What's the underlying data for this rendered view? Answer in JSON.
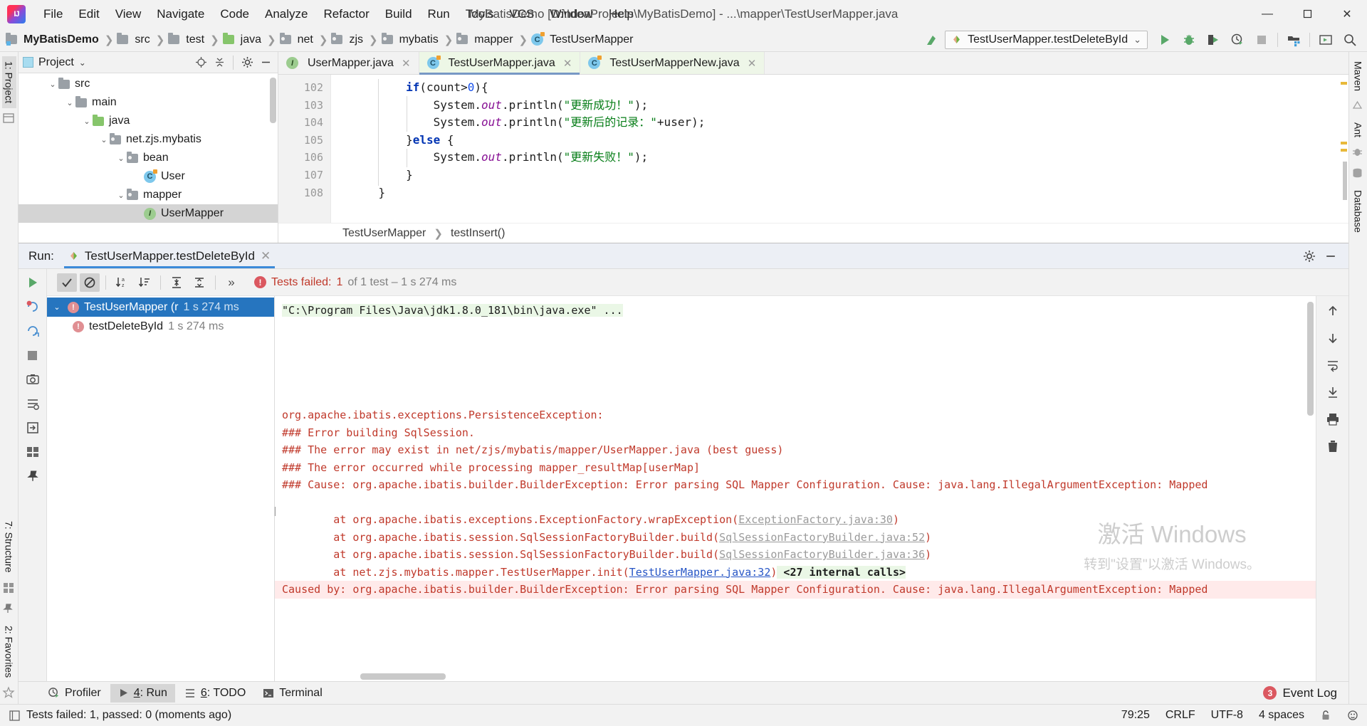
{
  "window": {
    "title": "MyBatisDemo [D:\\IdeaProjects\\MyBatisDemo] - ...\\mapper\\TestUserMapper.java",
    "minimize": "—",
    "maximize": "▢",
    "close": "✕"
  },
  "menu": {
    "items": [
      "File",
      "Edit",
      "View",
      "Navigate",
      "Code",
      "Analyze",
      "Refactor",
      "Build",
      "Run",
      "Tools",
      "VCS",
      "Window",
      "Help"
    ]
  },
  "breadcrumb": {
    "separator": "❯",
    "items": [
      {
        "label": "MyBatisDemo",
        "icon": "module-folder-icon"
      },
      {
        "label": "src",
        "icon": "folder-icon"
      },
      {
        "label": "test",
        "icon": "folder-icon"
      },
      {
        "label": "java",
        "icon": "source-folder-icon"
      },
      {
        "label": "net",
        "icon": "package-icon"
      },
      {
        "label": "zjs",
        "icon": "package-icon"
      },
      {
        "label": "mybatis",
        "icon": "package-icon"
      },
      {
        "label": "mapper",
        "icon": "package-icon"
      },
      {
        "label": "TestUserMapper",
        "icon": "class-icon"
      }
    ]
  },
  "toolbar": {
    "run_config": "TestUserMapper.testDeleteById",
    "dropdown_caret": "⌄",
    "buttons": [
      {
        "name": "run-button",
        "glyph": "▶"
      },
      {
        "name": "debug-button",
        "glyph": "bug"
      },
      {
        "name": "run-with-coverage-button",
        "glyph": "coverage"
      },
      {
        "name": "profiler-button",
        "glyph": "profile"
      },
      {
        "name": "stop-button",
        "glyph": "■"
      },
      {
        "name": "project-structure-button",
        "glyph": "struct"
      },
      {
        "name": "select-opened-file-button",
        "glyph": "selectfile"
      },
      {
        "name": "search-everywhere-button",
        "glyph": "search"
      }
    ]
  },
  "left_rail": {
    "items": [
      {
        "label": "1: Project",
        "selected": true
      },
      {
        "label": "2: Favorites",
        "selected": false
      },
      {
        "label": "7: Structure",
        "selected": false
      }
    ]
  },
  "right_rail": {
    "items": [
      {
        "label": "Maven"
      },
      {
        "label": "Ant"
      },
      {
        "label": "Database"
      }
    ]
  },
  "project": {
    "title": "Project",
    "title_caret": "⌄",
    "actions": [
      "locate-icon",
      "collapse-all-icon",
      "settings-icon",
      "hide-icon"
    ],
    "tree": [
      {
        "label": "src",
        "depth": 1,
        "chev": "⌄",
        "icon": "folder-icon",
        "selected": false
      },
      {
        "label": "main",
        "depth": 2,
        "chev": "⌄",
        "icon": "folder-icon",
        "selected": false
      },
      {
        "label": "java",
        "depth": 3,
        "chev": "⌄",
        "icon": "source-folder-icon",
        "selected": false
      },
      {
        "label": "net.zjs.mybatis",
        "depth": 4,
        "chev": "⌄",
        "icon": "package-icon",
        "selected": false
      },
      {
        "label": "bean",
        "depth": 5,
        "chev": "⌄",
        "icon": "package-icon",
        "selected": false
      },
      {
        "label": "User",
        "depth": 6,
        "chev": "",
        "icon": "class-icon",
        "selected": false
      },
      {
        "label": "mapper",
        "depth": 5,
        "chev": "⌄",
        "icon": "package-icon",
        "selected": false
      },
      {
        "label": "UserMapper",
        "depth": 6,
        "chev": "",
        "icon": "interface-icon",
        "selected": true
      }
    ]
  },
  "editor": {
    "tabs": [
      {
        "label": "UserMapper.java",
        "icon": "interface-icon",
        "active": false,
        "close": "✕"
      },
      {
        "label": "TestUserMapper.java",
        "icon": "class-icon",
        "active": true,
        "close": "✕"
      },
      {
        "label": "TestUserMapperNew.java",
        "icon": "class-icon",
        "active": false,
        "close": "✕"
      }
    ],
    "line_numbers": [
      "102",
      "103",
      "104",
      "105",
      "106",
      "107",
      "108"
    ],
    "code_lines": [
      "        if(count>0){",
      "            System.out.println(\"更新成功！\");",
      "            System.out.println(\"更新后的记录：\"+user);",
      "        }else {",
      "            System.out.println(\"更新失败！\");",
      "        }",
      "    }"
    ],
    "breadcrumb": {
      "separator": "❯",
      "items": [
        "TestUserMapper",
        "testInsert()"
      ]
    }
  },
  "run_window": {
    "label": "Run:",
    "tab_title": "TestUserMapper.testDeleteById",
    "tab_close": "✕",
    "settings_icon": "gear-icon",
    "hide_icon": "hide-icon",
    "left_tools": [
      {
        "name": "rerun-button",
        "glyph": "▶"
      },
      {
        "name": "rerun-failed-tests-button",
        "glyph": "rerunfail"
      },
      {
        "name": "toggle-auto-test-button",
        "glyph": "autotest"
      },
      {
        "name": "stop-button",
        "glyph": "■"
      },
      {
        "name": "export-test-results-button",
        "glyph": "camera"
      },
      {
        "name": "test-history-button",
        "glyph": "history"
      },
      {
        "name": "open-button",
        "glyph": "open"
      },
      {
        "name": "layout-button",
        "glyph": "layout"
      },
      {
        "name": "pin-tab-button",
        "glyph": "pin"
      }
    ],
    "toolbar": {
      "show_passed": "✓",
      "hide_ignored": "⊘",
      "sort_alphabetically": "↓a z",
      "sort_by_duration": "↓≡",
      "expand_all": "⇲",
      "collapse_all": "⇱",
      "more": "»"
    },
    "status": {
      "prefix": "Tests failed:",
      "failed_count": "1",
      "suffix": "of 1 test – 1 s 274 ms"
    },
    "tests": [
      {
        "label": "TestUserMapper (r",
        "duration": "1 s 274 ms",
        "depth": 0,
        "chev": "⌄",
        "selected": true
      },
      {
        "label": "testDeleteById",
        "duration": "1 s 274 ms",
        "depth": 1,
        "chev": "",
        "selected": false
      }
    ],
    "console": [
      {
        "text": "\"C:\\Program Files\\Java\\jdk1.8.0_181\\bin\\java.exe\" ...",
        "style": "cmd-highlight"
      },
      {
        "text": "",
        "style": "blank"
      },
      {
        "text": "",
        "style": "blank"
      },
      {
        "text": "",
        "style": "blank"
      },
      {
        "text": "",
        "style": "blank"
      },
      {
        "text": "",
        "style": "blank"
      },
      {
        "text": "org.apache.ibatis.exceptions.PersistenceException:",
        "style": "error"
      },
      {
        "text": "### Error building SqlSession.",
        "style": "error"
      },
      {
        "text": "### The error may exist in net/zjs/mybatis/mapper/UserMapper.java (best guess)",
        "style": "error"
      },
      {
        "text": "### The error occurred while processing mapper_resultMap[userMap]",
        "style": "error"
      },
      {
        "text": "### Cause: org.apache.ibatis.builder.BuilderException: Error parsing SQL Mapper Configuration. Cause: java.lang.IllegalArgumentException: Mapped",
        "style": "error"
      },
      {
        "text": "",
        "style": "blank"
      },
      {
        "text": "\tat org.apache.ibatis.exceptions.ExceptionFactory.wrapException(",
        "link": "ExceptionFactory.java:30",
        "tail": ")",
        "style": "error-link"
      },
      {
        "text": "\tat org.apache.ibatis.session.SqlSessionFactoryBuilder.build(",
        "link": "SqlSessionFactoryBuilder.java:52",
        "tail": ")",
        "style": "error-link"
      },
      {
        "text": "\tat org.apache.ibatis.session.SqlSessionFactoryBuilder.build(",
        "link": "SqlSessionFactoryBuilder.java:36",
        "tail": ")",
        "style": "error-link"
      },
      {
        "text": "\tat net.zjs.mybatis.mapper.TestUserMapper.init(",
        "link": "TestUserMapper.java:32",
        "tail": ")",
        "extra": "<27 internal calls>",
        "style": "error-link-blue"
      },
      {
        "text": "Caused by: org.apache.ibatis.builder.BuilderException: Error parsing SQL Mapper Configuration. Cause: java.lang.IllegalArgumentException: Mapped",
        "style": "error-selected"
      }
    ],
    "console_tools": [
      {
        "name": "up-arrow-icon",
        "glyph": "↑"
      },
      {
        "name": "down-arrow-icon",
        "glyph": "↓"
      },
      {
        "name": "soft-wrap-icon",
        "glyph": "⇥"
      },
      {
        "name": "scroll-to-end-icon",
        "glyph": "⤓"
      },
      {
        "name": "print-icon",
        "glyph": "print"
      },
      {
        "name": "clear-all-icon",
        "glyph": "trash"
      }
    ]
  },
  "watermark": {
    "line1": "激活 Windows",
    "line2": "转到\"设置\"以激活 Windows。"
  },
  "bottom_tools": {
    "items": [
      {
        "label": "Profiler",
        "mnemonic": "",
        "icon": "profiler-icon",
        "active": false
      },
      {
        "label": ": Run",
        "mnemonic": "4",
        "icon": "run-icon",
        "active": true
      },
      {
        "label": ": TODO",
        "mnemonic": "6",
        "icon": "todo-icon",
        "active": false
      },
      {
        "label": "Terminal",
        "mnemonic": "",
        "icon": "terminal-icon",
        "active": false
      }
    ],
    "event_log": {
      "label": "Event Log",
      "count": "3"
    }
  },
  "statusbar": {
    "message": "Tests failed: 1, passed: 0 (moments ago)",
    "caret_position": "79:25",
    "line_separator": "CRLF",
    "encoding": "UTF-8",
    "indent": "4 spaces",
    "lock_icon": "lock-icon",
    "face_icon": "inspection-icon"
  }
}
